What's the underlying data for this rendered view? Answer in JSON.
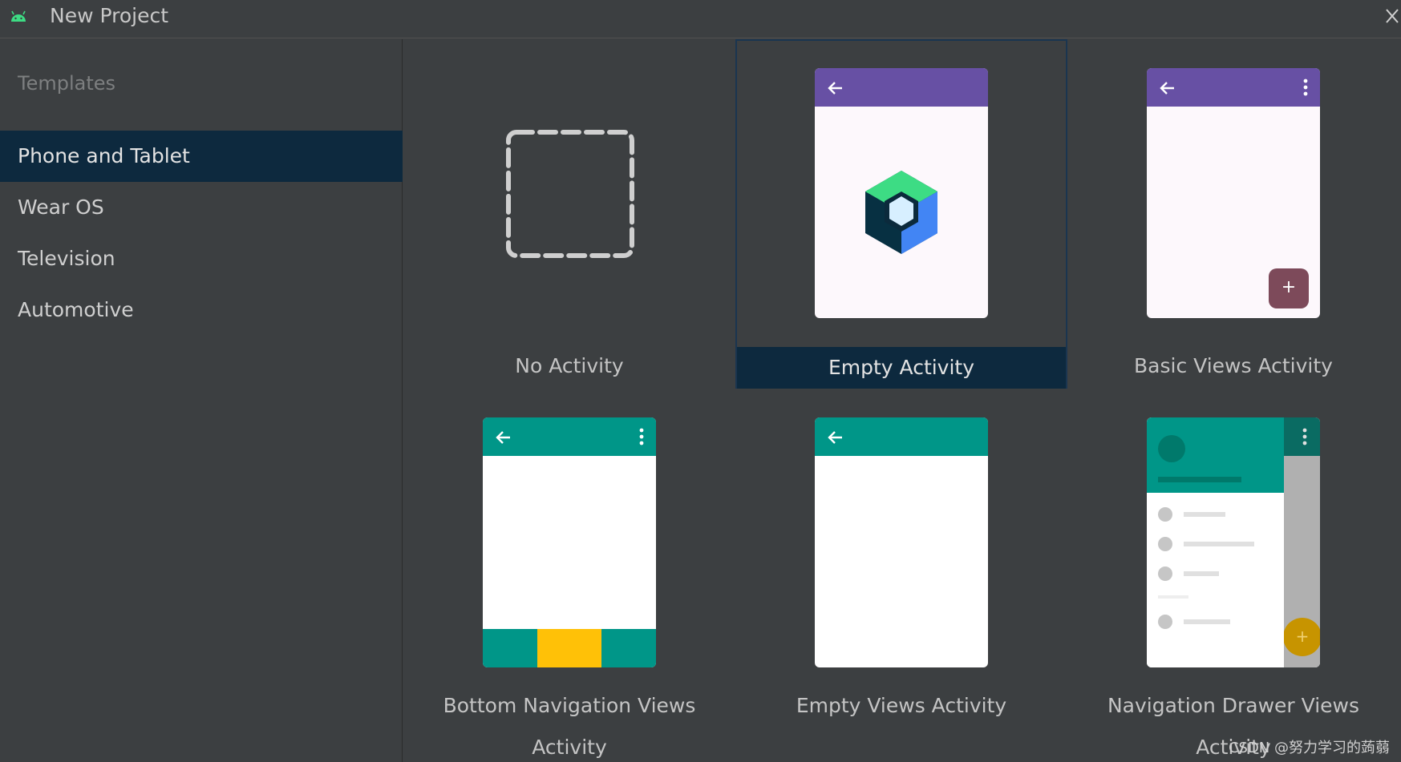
{
  "window": {
    "title": "New Project",
    "close_glyph": "✕"
  },
  "sidebar": {
    "heading": "Templates",
    "items": [
      {
        "label": "Phone and Tablet",
        "selected": true
      },
      {
        "label": "Wear OS",
        "selected": false
      },
      {
        "label": "Television",
        "selected": false
      },
      {
        "label": "Automotive",
        "selected": false
      }
    ]
  },
  "templates": [
    {
      "label": "No Activity",
      "icon": "dashed-placeholder-icon",
      "selected": false
    },
    {
      "label": "Empty Activity",
      "icon": "jetpack-compose-icon",
      "selected": true
    },
    {
      "label": "Basic Views Activity",
      "icon": "basic-views-preview",
      "selected": false,
      "fab": "+"
    },
    {
      "label": "Bottom Navigation Views Activity",
      "icon": "bottom-navigation-preview",
      "selected": false
    },
    {
      "label": "Empty Views Activity",
      "icon": "empty-views-preview",
      "selected": false
    },
    {
      "label": "Navigation Drawer Views Activity",
      "icon": "navigation-drawer-preview",
      "selected": false,
      "fab": "+"
    }
  ],
  "colors": {
    "background": "#3c3f41",
    "selection": "#0d293e",
    "purple_appbar": "#6750a4",
    "teal_appbar": "#009688",
    "fab_maroon": "#7d4a5a",
    "bottom_nav_accent": "#ffc107",
    "android_green": "#3ddc84"
  },
  "watermark": "CSDN @努力学习的蒟蒻"
}
